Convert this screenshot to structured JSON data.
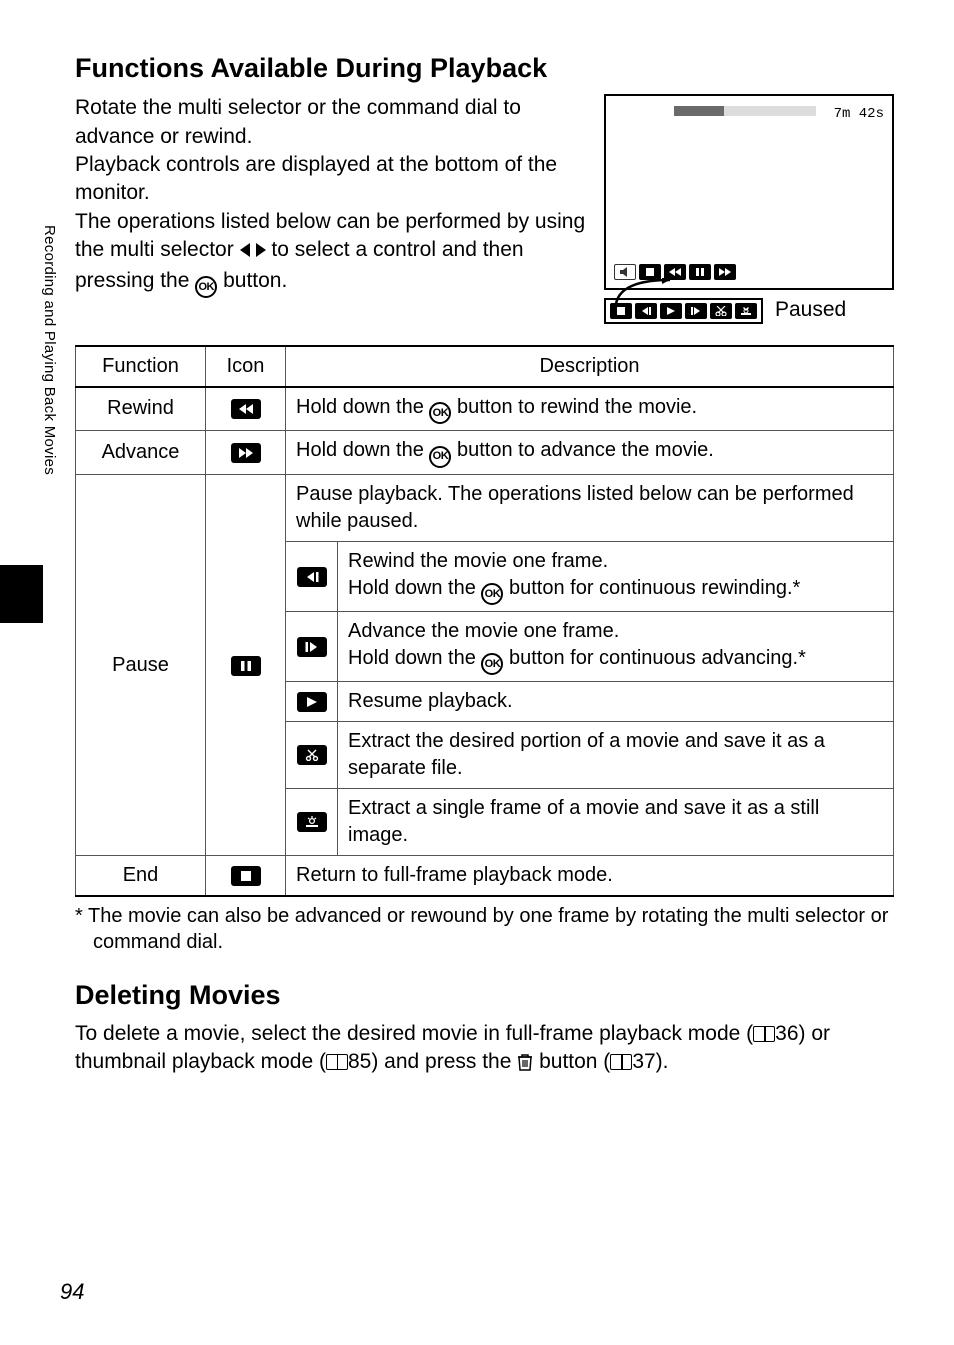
{
  "sideTab": "Recording and Playing Back Movies",
  "pageNumber": "94",
  "heading1": "Functions Available During Playback",
  "intro": {
    "p1": "Rotate the multi selector or the command dial to advance or rewind.",
    "p2": "Playback controls are displayed at the bottom of the monitor.",
    "p3a": "The operations listed below can be performed by using the multi selector ",
    "p3b": " to select a control and then pressing the ",
    "p3c": " button."
  },
  "screen": {
    "time": "7m 42s",
    "pausedLabel": "Paused"
  },
  "ok": "OK",
  "table": {
    "headers": {
      "fn": "Function",
      "icon": "Icon",
      "desc": "Description"
    },
    "rewind": {
      "fn": "Rewind",
      "desc_a": "Hold down the ",
      "desc_b": " button to rewind the movie."
    },
    "advance": {
      "fn": "Advance",
      "desc_a": "Hold down the ",
      "desc_b": " button to advance the movie."
    },
    "pause": {
      "fn": "Pause",
      "desc_top": "Pause playback. The operations listed below can be performed while paused.",
      "frameback": {
        "a": "Rewind the movie one frame.",
        "b": "Hold down the ",
        "c": " button for continuous rewinding.*"
      },
      "framefwd": {
        "a": "Advance the movie one frame.",
        "b": "Hold down the ",
        "c": " button for continuous advancing.*"
      },
      "resume": "Resume playback.",
      "extract": "Extract the desired portion of a movie and save it as a separate file.",
      "still": "Extract a single frame of a movie and save it as a still image."
    },
    "end": {
      "fn": "End",
      "desc": "Return to full-frame playback mode."
    }
  },
  "footnote": "*  The movie can also be advanced or rewound by one frame by rotating the multi selector or command dial.",
  "heading2": "Deleting Movies",
  "del": {
    "a": "To delete a movie, select the desired movie in full-frame playback mode (",
    "ref1": "36) or thumbnail playback mode (",
    "ref2": "85) and press the ",
    "b": " button (",
    "ref3": "37)."
  }
}
